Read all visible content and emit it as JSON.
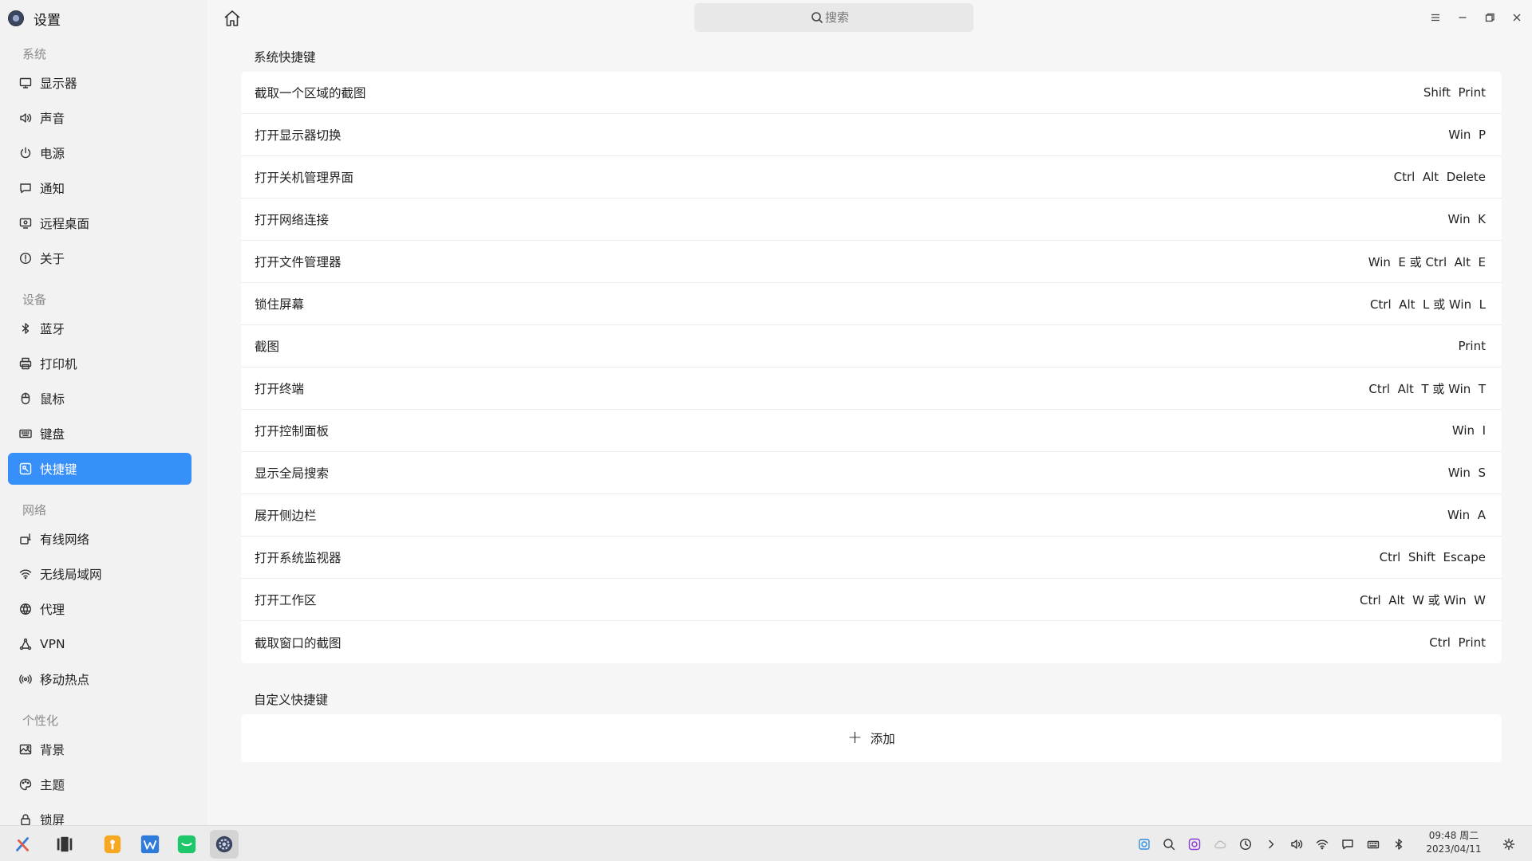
{
  "app": {
    "title": "设置"
  },
  "sidebar": {
    "groups": [
      {
        "title": "系统",
        "items": [
          "显示器",
          "声音",
          "电源",
          "通知",
          "远程桌面",
          "关于"
        ]
      },
      {
        "title": "设备",
        "items": [
          "蓝牙",
          "打印机",
          "鼠标",
          "键盘",
          "快捷键"
        ]
      },
      {
        "title": "网络",
        "items": [
          "有线网络",
          "无线局域网",
          "代理",
          "VPN",
          "移动热点"
        ]
      },
      {
        "title": "个性化",
        "items": [
          "背景",
          "主题",
          "锁屏"
        ]
      }
    ],
    "active": "快捷键"
  },
  "search": {
    "placeholder": "搜索"
  },
  "system_shortcuts": {
    "title": "系统快捷键",
    "rows": [
      {
        "name": "截取一个区域的截图",
        "keys": "Shift  Print"
      },
      {
        "name": "打开显示器切换",
        "keys": "Win  P"
      },
      {
        "name": "打开关机管理界面",
        "keys": "Ctrl  Alt  Delete"
      },
      {
        "name": "打开网络连接",
        "keys": "Win  K"
      },
      {
        "name": "打开文件管理器",
        "keys": "Win  E 或 Ctrl  Alt  E"
      },
      {
        "name": "锁住屏幕",
        "keys": "Ctrl  Alt  L 或 Win  L"
      },
      {
        "name": "截图",
        "keys": "Print"
      },
      {
        "name": "打开终端",
        "keys": "Ctrl  Alt  T 或 Win  T"
      },
      {
        "name": "打开控制面板",
        "keys": "Win  I"
      },
      {
        "name": "显示全局搜索",
        "keys": "Win  S"
      },
      {
        "name": "展开侧边栏",
        "keys": "Win  A"
      },
      {
        "name": "打开系统监视器",
        "keys": "Ctrl  Shift  Escape"
      },
      {
        "name": "打开工作区",
        "keys": "Ctrl  Alt  W 或 Win  W"
      },
      {
        "name": "截取窗口的截图",
        "keys": "Ctrl  Print"
      }
    ]
  },
  "custom_shortcuts": {
    "title": "自定义快捷键",
    "add_label": "添加"
  },
  "taskbar": {
    "time": "09:48 周二",
    "date": "2023/04/11"
  },
  "colors": {
    "accent": "#3790fa",
    "background": "#f6f6f6",
    "card": "#ffffff",
    "taskbar": "#ececec"
  }
}
